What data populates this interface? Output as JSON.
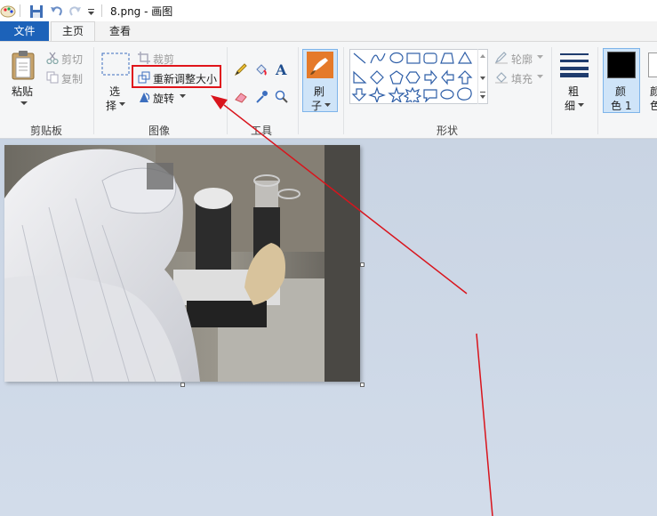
{
  "title": {
    "filename": "8.png - 画图"
  },
  "tabs": [
    {
      "label": "文件"
    },
    {
      "label": "主页"
    },
    {
      "label": "查看"
    }
  ],
  "clipboard": {
    "paste": "粘贴",
    "cut": "剪切",
    "copy": "复制",
    "group": "剪贴板"
  },
  "image": {
    "select_top": "选",
    "select_bottom": "择",
    "crop": "裁剪",
    "resize": "重新调整大小",
    "rotate": "旋转",
    "group": "图像"
  },
  "tools": {
    "group": "工具"
  },
  "brush": {
    "top": "刷",
    "bottom": "子"
  },
  "shapes": {
    "outline": "轮廓",
    "fill": "填充",
    "group": "形状"
  },
  "size": {
    "top": "粗",
    "bottom": "细"
  },
  "color1": {
    "top": "颜",
    "bottom": "色 1"
  },
  "color2": {
    "top": "颜",
    "bottom": "色"
  },
  "colors": {
    "file_tab": "#1c62b9",
    "highlight_box": "#e0141a",
    "arrow": "#d9141c",
    "color1": "#000000"
  }
}
